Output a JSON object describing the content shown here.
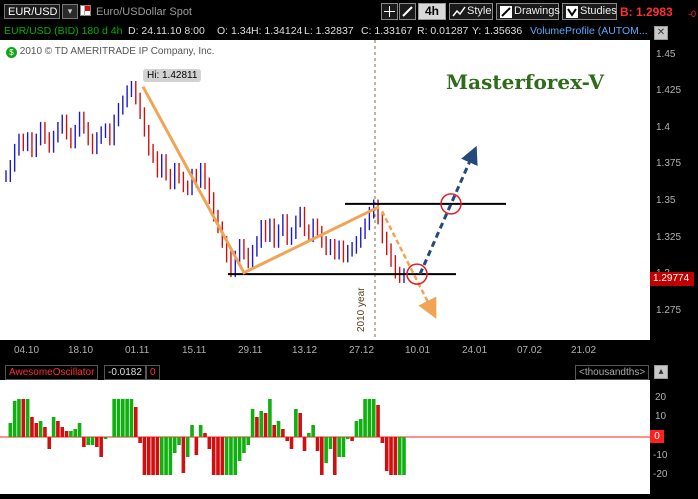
{
  "toolbar": {
    "symbol": "EUR/USD",
    "description": "Euro/USDollar Spot",
    "timeframe": "4h",
    "style_label": "Style",
    "drawings_label": "Drawings",
    "studies_label": "Studies",
    "bid_value": "B: 1.2983",
    "bid_suffix": "-0"
  },
  "infobar": {
    "title": "EUR/USD (BID) 180 d 4h",
    "date": "D: 24.11.10 8:00",
    "open": "O: 1.34",
    "high": "H: 1.34124",
    "low": "L: 1.32837",
    "close": "C: 1.33167",
    "range": "R: 0.01287",
    "y": "Y: 1.35636",
    "volume_profile": "VolumeProfile (AUTOM..."
  },
  "chart": {
    "copyright": "2010 © TD AMERITRADE IP Company, Inc.",
    "hi_label": "Hi: 1.42811",
    "brand": "Masterforex-V",
    "year_label": "2010 year",
    "current_price": "1.29774",
    "colors": {
      "up": "#1a1ad0",
      "down": "#d01010",
      "trendline": "#f2a455",
      "brand": "#2e6b1a",
      "projection": "#244a7a",
      "circle": "#e02020",
      "price_tag": "#c00000"
    }
  },
  "chart_data": {
    "type": "line",
    "title": "EUR/USD (BID) 180 d 4h",
    "x": [
      "04.10",
      "18.10",
      "01.11",
      "15.11",
      "29.11",
      "13.12",
      "27.12",
      "10.01",
      "24.01",
      "07.02",
      "21.02"
    ],
    "ylim": [
      1.255,
      1.46
    ],
    "yticks": [
      "1.45",
      "1.425",
      "1.4",
      "1.375",
      "1.35",
      "1.325",
      "1.3",
      "1.275"
    ],
    "series": [
      {
        "values": [
          1.367,
          1.374,
          1.385,
          1.392,
          1.388,
          1.393,
          1.384,
          1.392,
          1.4,
          1.393,
          1.387,
          1.394,
          1.4,
          1.405,
          1.396,
          1.39,
          1.398,
          1.407,
          1.4,
          1.392,
          1.386,
          1.393,
          1.397,
          1.399,
          1.392,
          1.405,
          1.413,
          1.418,
          1.425,
          1.428,
          1.42,
          1.41,
          1.398,
          1.385,
          1.38,
          1.37,
          1.378,
          1.368,
          1.362,
          1.372,
          1.366,
          1.36,
          1.358,
          1.368,
          1.363,
          1.372,
          1.362,
          1.352,
          1.34,
          1.332,
          1.322,
          1.312,
          1.302,
          1.312,
          1.32,
          1.314,
          1.308,
          1.316,
          1.322,
          1.333,
          1.326,
          1.334,
          1.322,
          1.33,
          1.337,
          1.324,
          1.328,
          1.336,
          1.342,
          1.33,
          1.326,
          1.334,
          1.329,
          1.322,
          1.317,
          1.32,
          1.314,
          1.319,
          1.312,
          1.316,
          1.318,
          1.322,
          1.328,
          1.334,
          1.342,
          1.347,
          1.338,
          1.325,
          1.317,
          1.309,
          1.301,
          1.298,
          1.3
        ]
      }
    ],
    "annotations": {
      "hi": 1.42811,
      "last": 1.29774,
      "resistance": 1.348,
      "support": 1.3
    }
  },
  "xaxis": {
    "ticks": [
      "04.10",
      "18.10",
      "01.11",
      "15.11",
      "29.11",
      "13.12",
      "27.12",
      "10.01",
      "24.01",
      "07.02",
      "21.02"
    ]
  },
  "oscillator": {
    "name": "AwesomeOscillator",
    "value": "-0.0182",
    "extra": "0",
    "units": "<thousandths>",
    "zero_tag": "0",
    "yticks": [
      "20",
      "10",
      "-10",
      "-20"
    ],
    "colors": {
      "up": "#10b010",
      "down": "#d01010",
      "zero": "#ff2020"
    }
  }
}
